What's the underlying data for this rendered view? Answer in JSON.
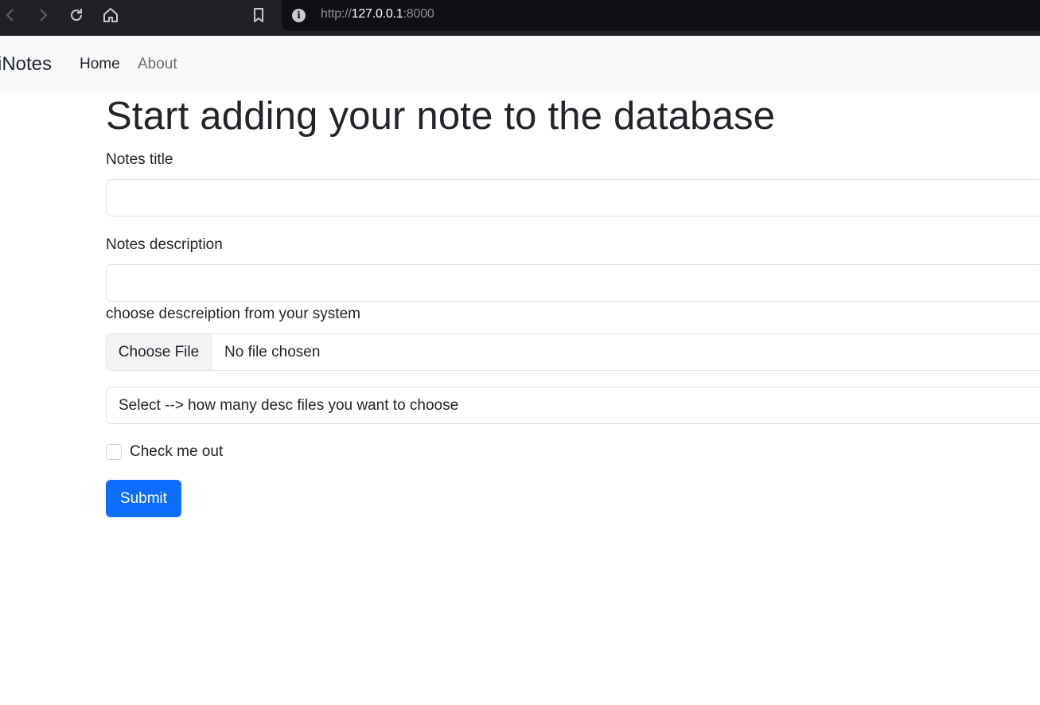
{
  "browser": {
    "url_scheme": "http://",
    "url_host": "127.0.0.1",
    "url_port": ":8000",
    "icons": [
      "back-icon",
      "forward-icon",
      "reload-icon",
      "home-icon",
      "bookmark-icon",
      "site-info-icon"
    ]
  },
  "navbar": {
    "brand": "iNotes",
    "links": [
      {
        "label": "Home"
      },
      {
        "label": "About"
      }
    ]
  },
  "main": {
    "heading": "Start adding your note to the database",
    "title_label": "Notes title",
    "title_value": "",
    "description_label": "Notes description",
    "description_value": "",
    "file_label": "choose descreiption from your system",
    "file_button": "Choose File",
    "file_status": "No file chosen",
    "select_value": "Select --> how many desc files you want to choose",
    "checkbox_label": "Check me out",
    "checkbox_checked": false,
    "submit_label": "Submit"
  },
  "colors": {
    "primary": "#0d6efd",
    "navbar_bg": "#f8f9fa",
    "chrome_bg": "#202124"
  }
}
